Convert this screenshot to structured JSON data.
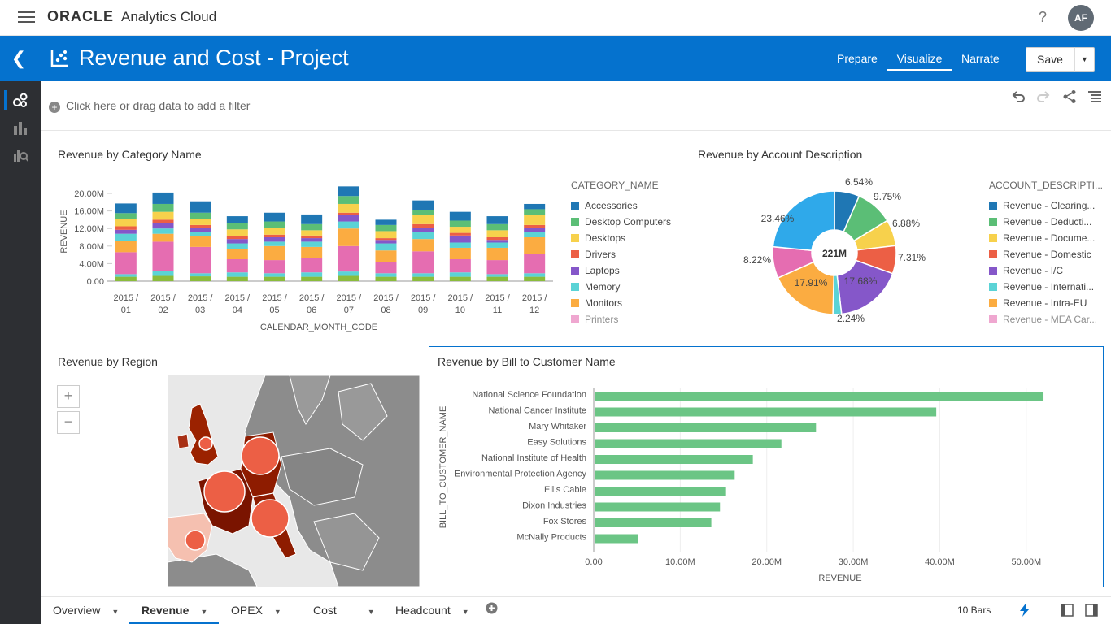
{
  "topbar": {
    "brand_oracle": "ORACLE",
    "brand_product": "Analytics Cloud",
    "help": "?",
    "avatar": "AF"
  },
  "header": {
    "title": "Revenue and Cost - Project",
    "nav": [
      "Prepare",
      "Visualize",
      "Narrate"
    ],
    "active_nav": "Visualize",
    "save_label": "Save",
    "background": "#0572ce"
  },
  "filterbar": {
    "add_filter_text": "Click here or drag data to add a filter"
  },
  "category_chart": {
    "title": "Revenue by Category Name",
    "legend_title": "CATEGORY_NAME",
    "legend": [
      {
        "name": "Accessories",
        "color": "#1f77b4"
      },
      {
        "name": "Desktop Computers",
        "color": "#5bbe76"
      },
      {
        "name": "Desktops",
        "color": "#f7d14c"
      },
      {
        "name": "Drivers",
        "color": "#ec5f45"
      },
      {
        "name": "Laptops",
        "color": "#8557c9"
      },
      {
        "name": "Memory",
        "color": "#5bd3d6"
      },
      {
        "name": "Monitors",
        "color": "#fbac41"
      },
      {
        "name": "Printers",
        "color": "#e56db1"
      }
    ]
  },
  "account_chart": {
    "title": "Revenue by Account Description",
    "legend_title": "ACCOUNT_DESCRIPTI...",
    "center_label": "221M",
    "legend": [
      {
        "name": "Revenue - Clearing...",
        "color": "#1f77b4"
      },
      {
        "name": "Revenue - Deducti...",
        "color": "#5bbe76"
      },
      {
        "name": "Revenue - Docume...",
        "color": "#f7d14c"
      },
      {
        "name": "Revenue - Domestic",
        "color": "#ec5f45"
      },
      {
        "name": "Revenue - I/C",
        "color": "#8557c9"
      },
      {
        "name": "Revenue - Internati...",
        "color": "#5bd3d6"
      },
      {
        "name": "Revenue - Intra-EU",
        "color": "#fbac41"
      },
      {
        "name": "Revenue - MEA Car...",
        "color": "#e56db1"
      }
    ]
  },
  "region_map": {
    "title": "Revenue by Region",
    "zoom_in": "+",
    "zoom_out": "−"
  },
  "customer_chart": {
    "title": "Revenue by Bill to Customer Name"
  },
  "tabs": [
    "Overview",
    "Revenue",
    "OPEX",
    "Cost",
    "Headcount"
  ],
  "active_tab": "Revenue",
  "status": {
    "bars": "10 Bars"
  },
  "chart_data": [
    {
      "type": "bar",
      "stacked": true,
      "title": "Revenue by Category Name",
      "xlabel": "CALENDAR_MONTH_CODE",
      "ylabel": "REVENUE",
      "ylim": [
        0,
        20000000
      ],
      "y_ticks": [
        "0.00",
        "4.00M",
        "8.00M",
        "12.00M",
        "16.00M",
        "20.00M"
      ],
      "categories": [
        "2015 / 01",
        "2015 / 02",
        "2015 / 03",
        "2015 / 04",
        "2015 / 05",
        "2015 / 06",
        "2015 / 07",
        "2015 / 08",
        "2015 / 09",
        "2015 / 10",
        "2015 / 11",
        "2015 / 12"
      ],
      "series_order_bottom_to_top": [
        "Desktop Computers",
        "Memory",
        "Printers",
        "Monitors",
        "Memory",
        "Laptops",
        "Drivers",
        "Desktops",
        "Desktop Computers",
        "Accessories"
      ],
      "segments": [
        {
          "color": "#8bbc3c",
          "values": [
            1.0,
            1.2,
            1.1,
            1.0,
            1.0,
            1.0,
            1.2,
            1.0,
            1.0,
            1.0,
            1.0,
            1.0
          ]
        },
        {
          "color": "#5bd3d6",
          "values": [
            0.6,
            1.2,
            0.7,
            1.0,
            0.8,
            1.0,
            1.0,
            0.8,
            0.8,
            1.0,
            0.6,
            0.8
          ]
        },
        {
          "color": "#e56db1",
          "values": [
            5.0,
            6.6,
            6.0,
            3.0,
            3.0,
            3.2,
            5.8,
            2.6,
            5.0,
            3.0,
            3.2,
            4.4
          ]
        },
        {
          "color": "#fbac41",
          "values": [
            2.6,
            1.8,
            2.4,
            2.4,
            3.2,
            2.6,
            4.0,
            2.6,
            2.8,
            2.6,
            2.8,
            3.8
          ]
        },
        {
          "color": "#5bd3d6",
          "values": [
            1.6,
            1.2,
            1.0,
            1.2,
            1.0,
            1.2,
            1.6,
            1.6,
            1.6,
            1.2,
            1.2,
            1.2
          ]
        },
        {
          "color": "#8557c9",
          "values": [
            0.9,
            1.2,
            1.0,
            1.0,
            1.0,
            0.8,
            1.4,
            0.8,
            1.0,
            1.6,
            0.6,
            1.0
          ]
        },
        {
          "color": "#ec5f45",
          "values": [
            0.8,
            0.8,
            0.6,
            0.6,
            0.6,
            0.6,
            0.6,
            0.4,
            0.8,
            0.6,
            0.6,
            0.6
          ]
        },
        {
          "color": "#f7d14c",
          "values": [
            1.6,
            1.8,
            1.4,
            1.6,
            1.6,
            1.2,
            2.0,
            1.6,
            2.0,
            1.4,
            1.6,
            2.2
          ]
        },
        {
          "color": "#5bbe76",
          "values": [
            1.4,
            1.8,
            1.4,
            1.4,
            1.4,
            1.4,
            1.8,
            1.4,
            1.2,
            1.4,
            1.4,
            1.4
          ]
        },
        {
          "color": "#1f77b4",
          "values": [
            2.2,
            2.6,
            2.6,
            1.6,
            2.0,
            2.2,
            2.2,
            1.2,
            2.2,
            2.0,
            1.8,
            1.2
          ]
        }
      ],
      "unit": "M"
    },
    {
      "type": "pie",
      "donut": true,
      "title": "Revenue by Account Description",
      "total_label": "221M",
      "slices": [
        {
          "label": "6.54%",
          "value": 6.54,
          "color": "#1f77b4"
        },
        {
          "label": "9.75%",
          "value": 9.75,
          "color": "#5bbe76"
        },
        {
          "label": "6.88%",
          "value": 6.88,
          "color": "#f7d14c"
        },
        {
          "label": "7.31%",
          "value": 7.31,
          "color": "#ec5f45"
        },
        {
          "label": "17.68%",
          "value": 17.68,
          "color": "#8557c9"
        },
        {
          "label": "2.24%",
          "value": 2.24,
          "color": "#5bd3d6"
        },
        {
          "label": "17.91%",
          "value": 17.91,
          "color": "#fbac41"
        },
        {
          "label": "8.22%",
          "value": 8.22,
          "color": "#e56db1"
        },
        {
          "label": "23.46%",
          "value": 23.46,
          "color": "#2fa9ea"
        }
      ]
    },
    {
      "type": "bar",
      "orientation": "horizontal",
      "title": "Revenue by Bill to Customer Name",
      "xlabel": "REVENUE",
      "ylabel": "BILL_TO_CUSTOMER_NAME",
      "xlim": [
        0,
        55000000
      ],
      "x_ticks": [
        "0.00",
        "10.00M",
        "20.00M",
        "30.00M",
        "40.00M",
        "50.00M"
      ],
      "categories": [
        "National Science Foundation",
        "National Cancer Institute",
        "Mary Whitaker",
        "Easy Solutions",
        "National Institute of Health",
        "Environmental Protection Agency",
        "Ellis Cable",
        "Dixon Industries",
        "Fox Stores",
        "McNally Products"
      ],
      "values": [
        51.9,
        39.5,
        25.6,
        21.6,
        18.3,
        16.2,
        15.2,
        14.5,
        13.5,
        5.0
      ],
      "unit": "M",
      "color": "#6bc585"
    }
  ]
}
